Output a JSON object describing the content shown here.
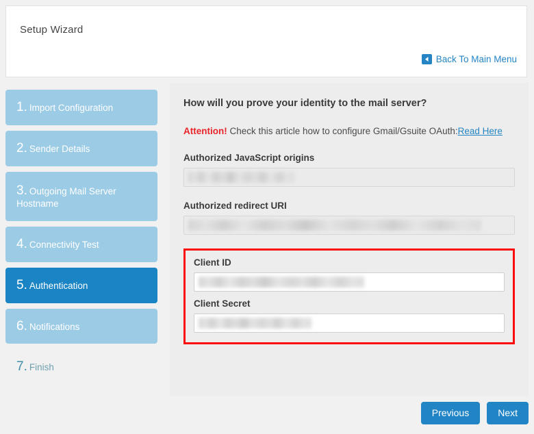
{
  "header": {
    "title": "Setup Wizard",
    "back_link": {
      "label": "Back To Main Menu",
      "icon": "arrow-left-icon"
    }
  },
  "sidebar": {
    "steps": [
      {
        "num": "1.",
        "label": "Import Configuration",
        "state": "available"
      },
      {
        "num": "2.",
        "label": "Sender Details",
        "state": "available"
      },
      {
        "num": "3.",
        "label": "Outgoing Mail Server Hostname",
        "state": "available"
      },
      {
        "num": "4.",
        "label": "Connectivity Test",
        "state": "available"
      },
      {
        "num": "5.",
        "label": "Authentication",
        "state": "active"
      },
      {
        "num": "6.",
        "label": "Notifications",
        "state": "available"
      },
      {
        "num": "7.",
        "label": "Finish",
        "state": "inactive"
      }
    ]
  },
  "main": {
    "heading": "How will you prove your identity to the mail server?",
    "notice": {
      "attention": "Attention!",
      "text": " Check this article how to configure Gmail/Gsuite OAuth:",
      "link_label": "Read Here"
    },
    "fields": [
      {
        "label": "Authorized JavaScript origins",
        "value": "",
        "redacted": true,
        "readonly": true
      },
      {
        "label": "Authorized redirect URI",
        "value": "",
        "redacted": true,
        "readonly": true
      }
    ],
    "highlighted_fields": [
      {
        "label": "Client ID",
        "value": "",
        "redacted": true,
        "readonly": false
      },
      {
        "label": "Client Secret",
        "value": "",
        "redacted": true,
        "readonly": false
      }
    ]
  },
  "footer": {
    "previous_label": "Previous",
    "next_label": "Next"
  },
  "colors": {
    "accent_blue": "#2185c5",
    "active_step": "#1a84c4",
    "step_blue": "#9ccbe5",
    "attention_red": "#e8242a",
    "highlight_red": "#fc0b0b",
    "page_bg": "#f1f1f1",
    "panel_bg": "#ededed"
  }
}
